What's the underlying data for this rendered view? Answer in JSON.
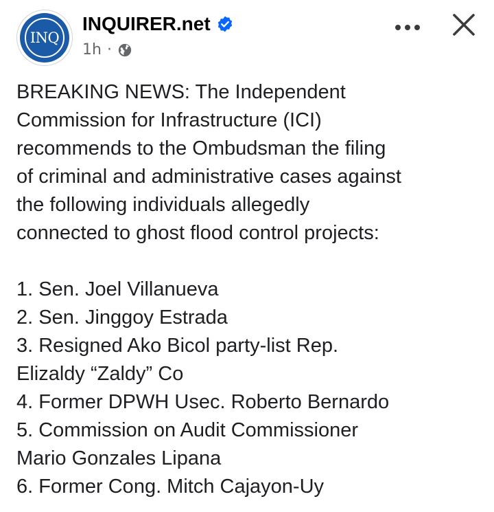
{
  "post": {
    "page_name": "INQUIRER.net",
    "avatar_text": "INQ",
    "timestamp": "1h",
    "separator": "·",
    "icons": {
      "verified": "verified-badge-icon",
      "audience": "globe-icon",
      "more": "more-options-icon",
      "close": "close-icon"
    },
    "colors": {
      "brand": "#1a5aa6",
      "verified": "#0866ff",
      "meta": "#65676b"
    },
    "body_intro_lines": [
      "BREAKING NEWS: The Independent",
      "Commission for Infrastructure (ICI)",
      "recommends to the Ombudsman the filing",
      "of criminal and administrative cases against",
      "the following individuals allegedly",
      "connected to ghost flood control projects:"
    ],
    "list_lines": [
      "1. Sen. Joel Villanueva",
      "2. Sen. Jinggoy Estrada",
      "3. Resigned Ako Bicol party-list Rep.",
      "Elizaldy “Zaldy” Co",
      "4. Former DPWH Usec. Roberto Bernardo",
      "5. Commission on Audit Commissioner",
      "Mario Gonzales Lipana",
      "6. Former Cong. Mitch Cajayon-Uy"
    ]
  }
}
